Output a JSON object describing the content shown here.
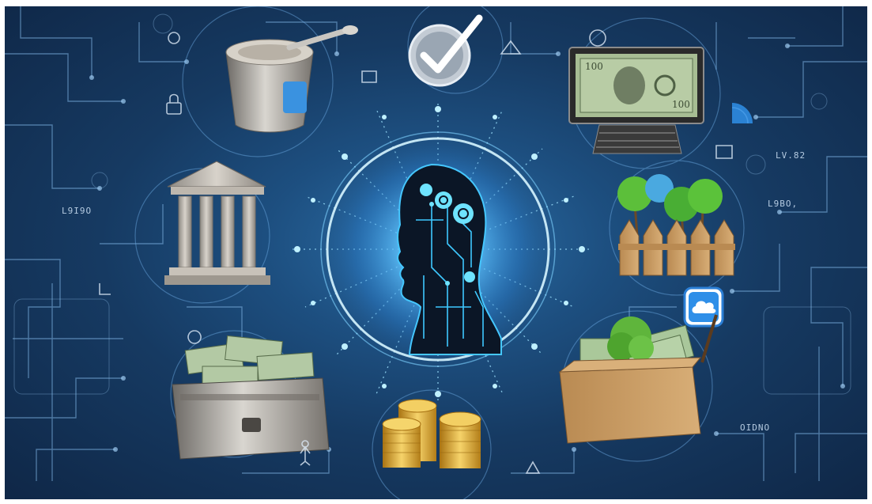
{
  "labels": {
    "left_mid": "L9I9O",
    "right_top": "LV.82",
    "right_mid": "L9BO,",
    "right_bottom": "OIDNO"
  },
  "colors": {
    "background_dark": "#0f2747",
    "background_glow": "#2c6fa8",
    "circuit": "#7fb4e4",
    "glow_ring": "#8fd3ff",
    "brain_glow": "#3ec9ff",
    "gold": "#d8a52c",
    "money_green": "#9fbf8f",
    "cardboard": "#c59a62",
    "tree_green": "#4fa83a"
  },
  "objects": [
    "central-ai-head",
    "stone-bank",
    "bowl-with-spoon",
    "checkmark-badge",
    "monitor-with-banknote",
    "trees-with-fence",
    "cloud-app-icon",
    "box-with-plant-and-money",
    "gold-coin-stacks",
    "chest-of-money"
  ]
}
